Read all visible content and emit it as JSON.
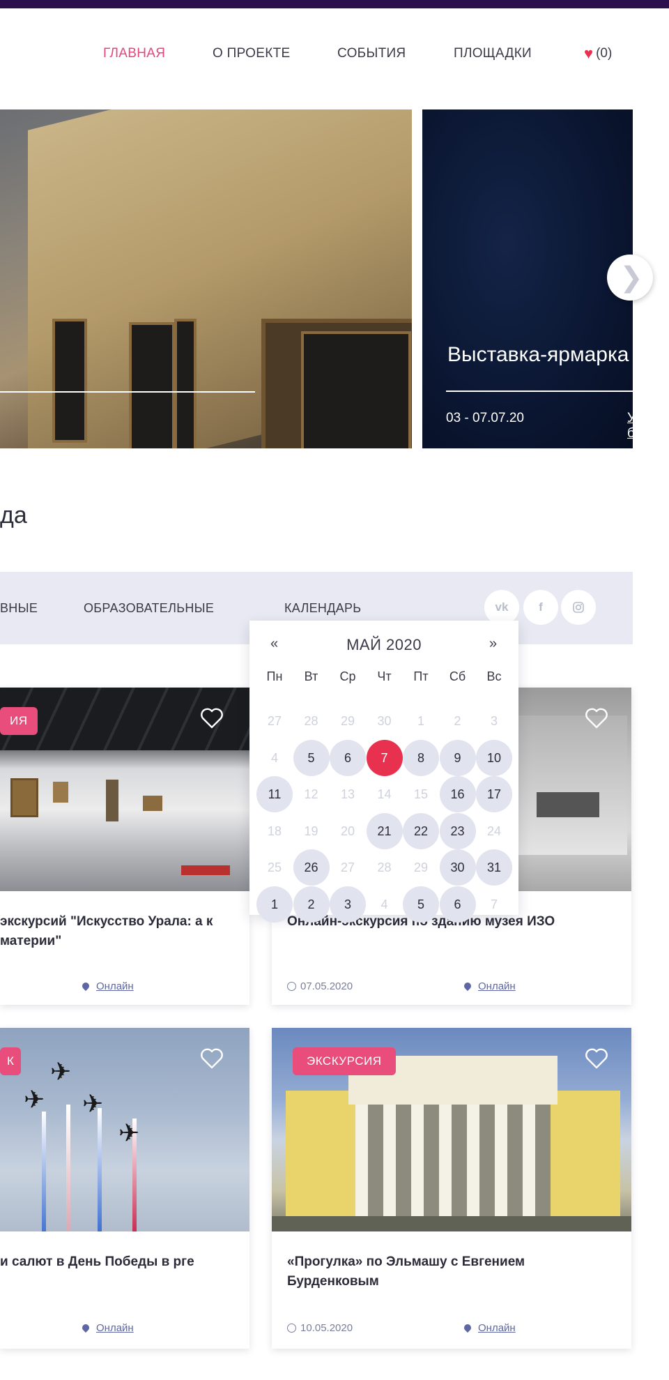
{
  "header": {
    "nav": [
      {
        "label": "ГЛАВНАЯ",
        "active": true
      },
      {
        "label": "О ПРОЕКТЕ",
        "active": false
      },
      {
        "label": "СОБЫТИЯ",
        "active": false
      },
      {
        "label": "ПЛОЩАДКИ",
        "active": false
      }
    ],
    "favorites_count": "(0)"
  },
  "slider": {
    "slide2": {
      "title": "Выставка-ярмарка",
      "date": "03 - 07.07.20",
      "more_link": "Узнать больше"
    }
  },
  "section": {
    "title_fragment": "да"
  },
  "filters": {
    "items": [
      "ВНЫЕ",
      "ОБРАЗОВАТЕЛЬНЫЕ",
      "КАЛЕНДАРЬ"
    ],
    "social": [
      "vk",
      "f",
      "ig"
    ]
  },
  "calendar": {
    "month": "МАЙ 2020",
    "prev": "«",
    "next": "»",
    "weekdays": [
      "Пн",
      "Вт",
      "Ср",
      "Чт",
      "Пт",
      "Сб",
      "Вс"
    ],
    "weeks": [
      [
        {
          "d": "27",
          "s": "muted"
        },
        {
          "d": "28",
          "s": "muted"
        },
        {
          "d": "29",
          "s": "muted"
        },
        {
          "d": "30",
          "s": "muted"
        },
        {
          "d": "1",
          "s": "muted"
        },
        {
          "d": "2",
          "s": "muted"
        },
        {
          "d": "3",
          "s": "muted"
        }
      ],
      [
        {
          "d": "4",
          "s": "muted"
        },
        {
          "d": "5",
          "s": "active"
        },
        {
          "d": "6",
          "s": "active"
        },
        {
          "d": "7",
          "s": "today"
        },
        {
          "d": "8",
          "s": "active"
        },
        {
          "d": "9",
          "s": "active"
        },
        {
          "d": "10",
          "s": "active"
        }
      ],
      [
        {
          "d": "11",
          "s": "active"
        },
        {
          "d": "12",
          "s": "muted"
        },
        {
          "d": "13",
          "s": "muted"
        },
        {
          "d": "14",
          "s": "muted"
        },
        {
          "d": "15",
          "s": "muted"
        },
        {
          "d": "16",
          "s": "active"
        },
        {
          "d": "17",
          "s": "active"
        }
      ],
      [
        {
          "d": "18",
          "s": "muted"
        },
        {
          "d": "19",
          "s": "muted"
        },
        {
          "d": "20",
          "s": "muted"
        },
        {
          "d": "21",
          "s": "active"
        },
        {
          "d": "22",
          "s": "active"
        },
        {
          "d": "23",
          "s": "active"
        },
        {
          "d": "24",
          "s": "muted"
        }
      ],
      [
        {
          "d": "25",
          "s": "muted"
        },
        {
          "d": "26",
          "s": "active"
        },
        {
          "d": "27",
          "s": "muted"
        },
        {
          "d": "28",
          "s": "muted"
        },
        {
          "d": "29",
          "s": "muted"
        },
        {
          "d": "30",
          "s": "active"
        },
        {
          "d": "31",
          "s": "active"
        }
      ],
      [
        {
          "d": "1",
          "s": "active"
        },
        {
          "d": "2",
          "s": "active"
        },
        {
          "d": "3",
          "s": "active"
        },
        {
          "d": "4",
          "s": "muted"
        },
        {
          "d": "5",
          "s": "active"
        },
        {
          "d": "6",
          "s": "active"
        },
        {
          "d": "7",
          "s": "muted"
        }
      ]
    ]
  },
  "cards": [
    {
      "badge": "ИЯ",
      "title": "экскурсий \"Искусство Урала: а к материи\"",
      "date": "",
      "location": "Онлайн"
    },
    {
      "badge": "",
      "title": "Онлайн-экскурсия по зданию музея ИЗО",
      "date": "07.05.2020",
      "location": "Онлайн"
    },
    {
      "badge": "К",
      "title": "и салют в День Победы в рге",
      "date": "",
      "location": "Онлайн"
    },
    {
      "badge": "ЭКСКУРСИЯ",
      "title": "«Прогулка» по Эльмашу с Евгением Бурденковым",
      "date": "10.05.2020",
      "location": "Онлайн"
    }
  ],
  "colors": {
    "accent": "#e8437b",
    "today": "#e8304f",
    "topbar": "#2c0f4d",
    "filter_bg": "#e8e9f2"
  }
}
